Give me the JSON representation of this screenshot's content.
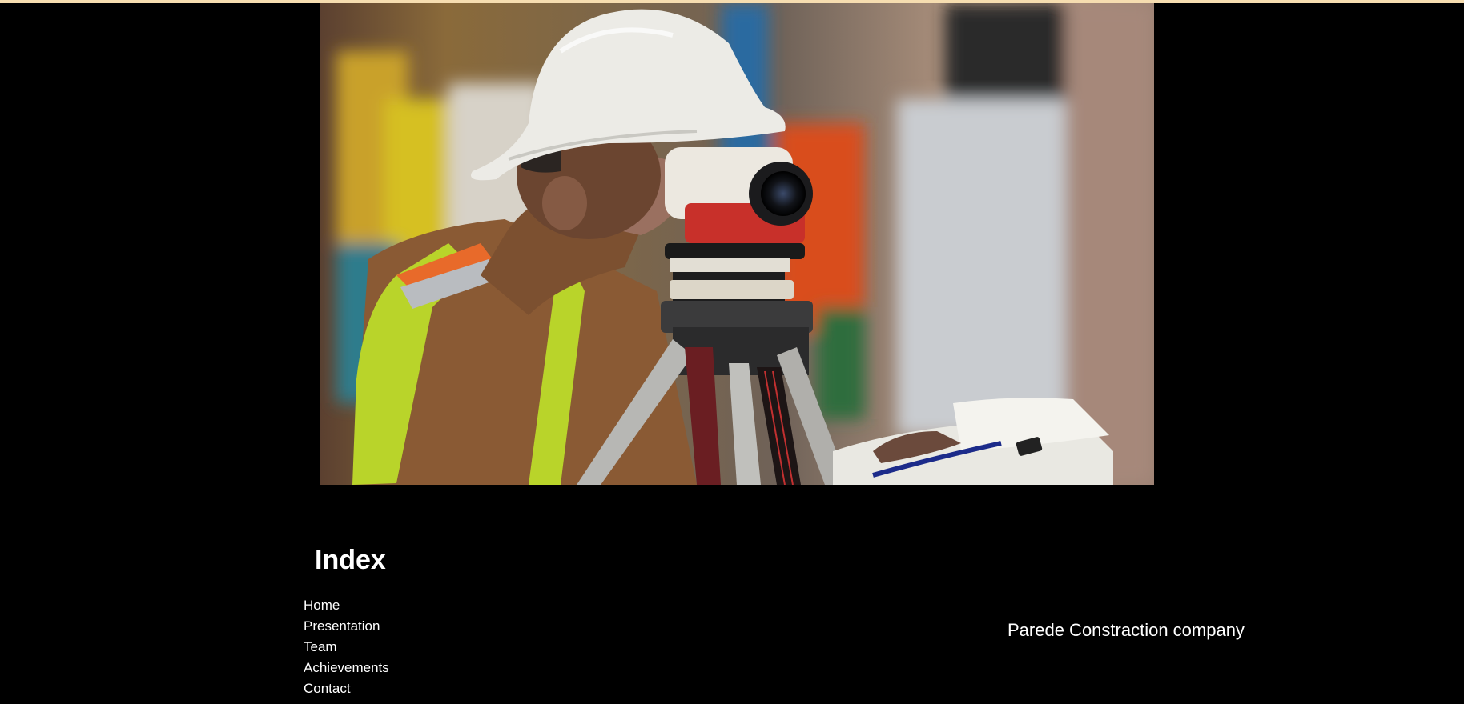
{
  "hero": {
    "image_description": "",
    "colors": {
      "background": "#000000",
      "accent_strip": "#f6ddb0"
    }
  },
  "index": {
    "title": "Index",
    "links": [
      {
        "label": "Home"
      },
      {
        "label": "Presentation"
      },
      {
        "label": "Team"
      },
      {
        "label": "Achievements"
      },
      {
        "label": "Contact"
      }
    ]
  },
  "company": {
    "name": "Parede Constraction company"
  }
}
